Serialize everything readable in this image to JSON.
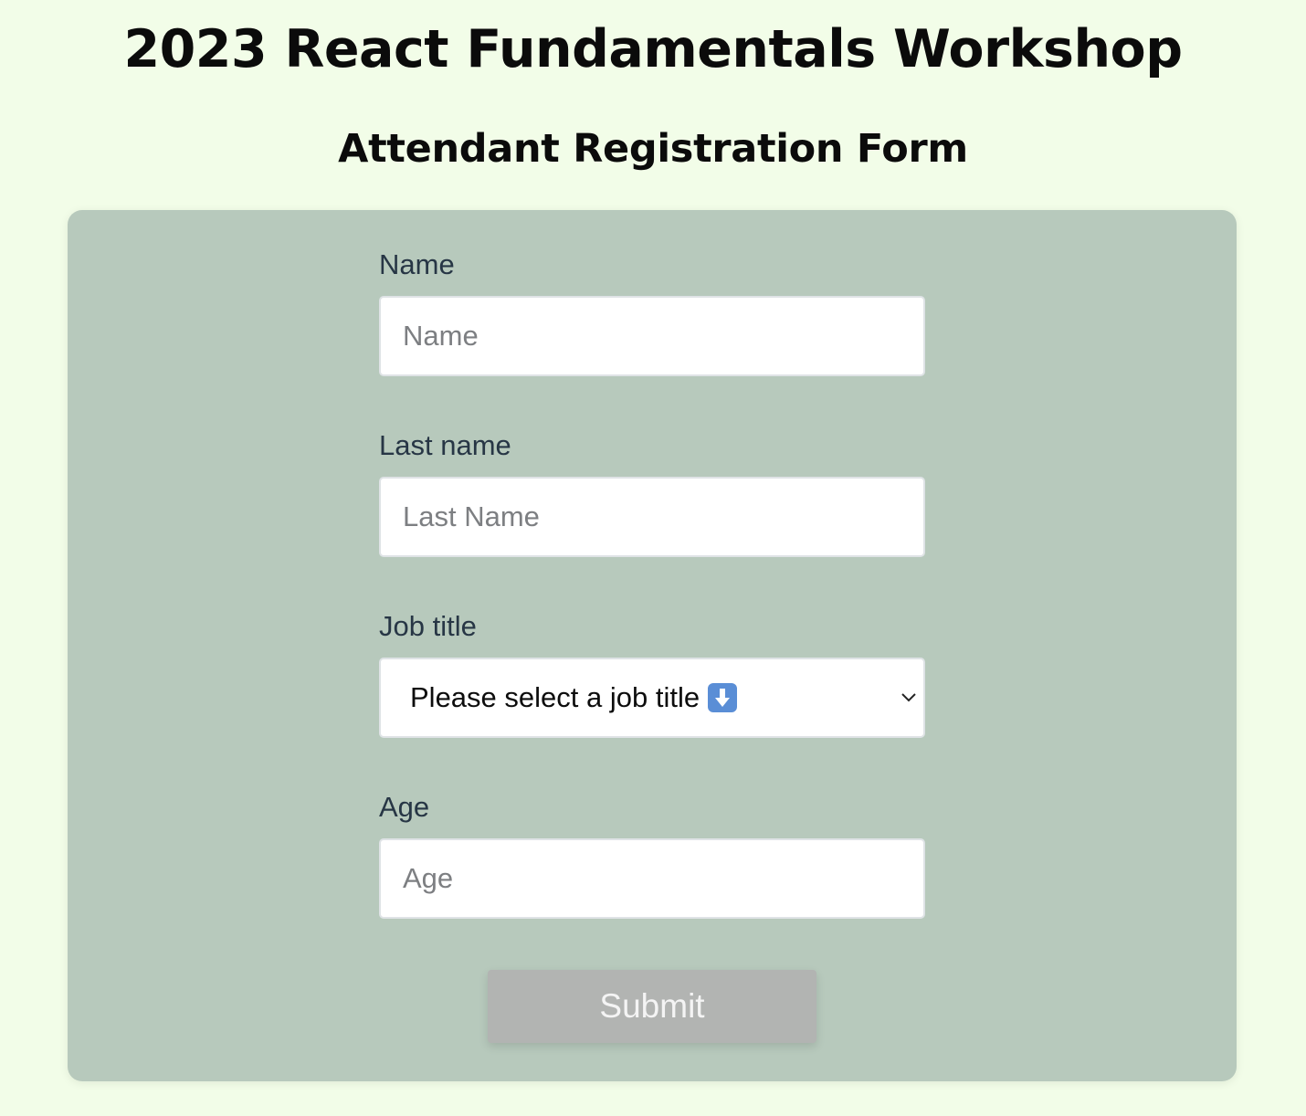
{
  "header": {
    "title": "2023 React Fundamentals Workshop",
    "subtitle": "Attendant Registration Form"
  },
  "form": {
    "fields": [
      {
        "label": "Name",
        "placeholder": "Name",
        "value": ""
      },
      {
        "label": "Last name",
        "placeholder": "Last Name",
        "value": ""
      },
      {
        "label": "Job title",
        "selected": "Please select a job title",
        "icon": "down-arrow-emoji-icon"
      },
      {
        "label": "Age",
        "placeholder": "Age",
        "value": ""
      }
    ],
    "submit_label": "Submit"
  },
  "colors": {
    "page_background": "#f2fde8",
    "card_background": "#b7c9bc",
    "submit_disabled": "#b2b4b2",
    "label_text": "#273645"
  }
}
